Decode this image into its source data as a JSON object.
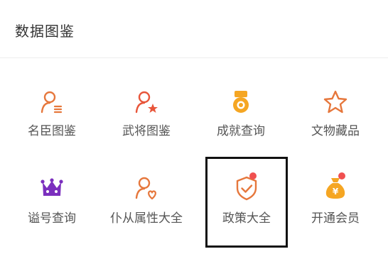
{
  "header": {
    "title": "数据图鉴"
  },
  "tiles": [
    {
      "label": "名臣图鉴",
      "icon": "minister-person-list-icon",
      "badge": false
    },
    {
      "label": "武将图鉴",
      "icon": "general-person-star-icon",
      "badge": false
    },
    {
      "label": "成就查询",
      "icon": "medal-icon",
      "badge": false
    },
    {
      "label": "文物藏品",
      "icon": "star-outline-icon",
      "badge": false
    },
    {
      "label": "谥号查询",
      "icon": "crown-icon",
      "badge": false
    },
    {
      "label": "仆从属性大全",
      "icon": "servant-person-heart-icon",
      "badge": false
    },
    {
      "label": "政策大全",
      "icon": "shield-check-icon",
      "badge": true,
      "selected": true
    },
    {
      "label": "开通会员",
      "icon": "money-bag-icon",
      "badge": true
    }
  ],
  "colors": {
    "icon_orange": "#e6773c",
    "icon_gold": "#f5a623",
    "icon_purple": "#7b2fbe",
    "badge_red": "#f05050",
    "text": "#555555",
    "title": "#333333"
  }
}
